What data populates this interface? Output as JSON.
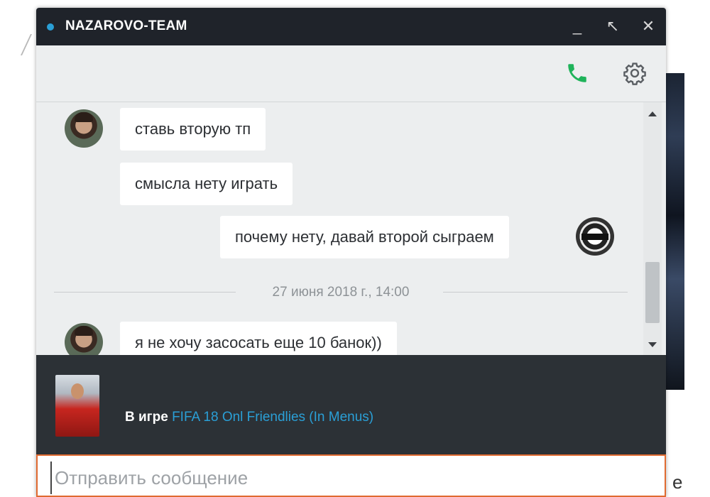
{
  "window": {
    "title": "NAZAROVO-TEAM",
    "status_color": "#2a9fd6",
    "controls": {
      "minimize": "_",
      "popout": "↖",
      "close": "✕"
    }
  },
  "toolbar": {
    "call_icon": "phone-icon",
    "settings_icon": "gear-icon",
    "call_color": "#1fb35a"
  },
  "messages": [
    {
      "sender": "contact",
      "text": "ставь вторую тп",
      "show_avatar": true
    },
    {
      "sender": "contact",
      "text": "смысла нету играть",
      "show_avatar": false
    },
    {
      "sender": "self",
      "text": "почему нету, давай второй сыграем",
      "show_avatar": true
    },
    {
      "type": "separator",
      "date": "27 июня 2018 г., 14:00"
    },
    {
      "sender": "contact",
      "text": "я не хочу засосать еще 10 банок))",
      "show_avatar": true
    }
  ],
  "now_playing": {
    "prefix": "В игре",
    "game": "FIFA 18 Onl Friendlies (In Menus)",
    "link_color": "#2a9fd6"
  },
  "composer": {
    "placeholder": "Отправить сообщение",
    "value": "",
    "border_color": "#e06a30"
  },
  "page_edge": {
    "glyph": "е"
  }
}
